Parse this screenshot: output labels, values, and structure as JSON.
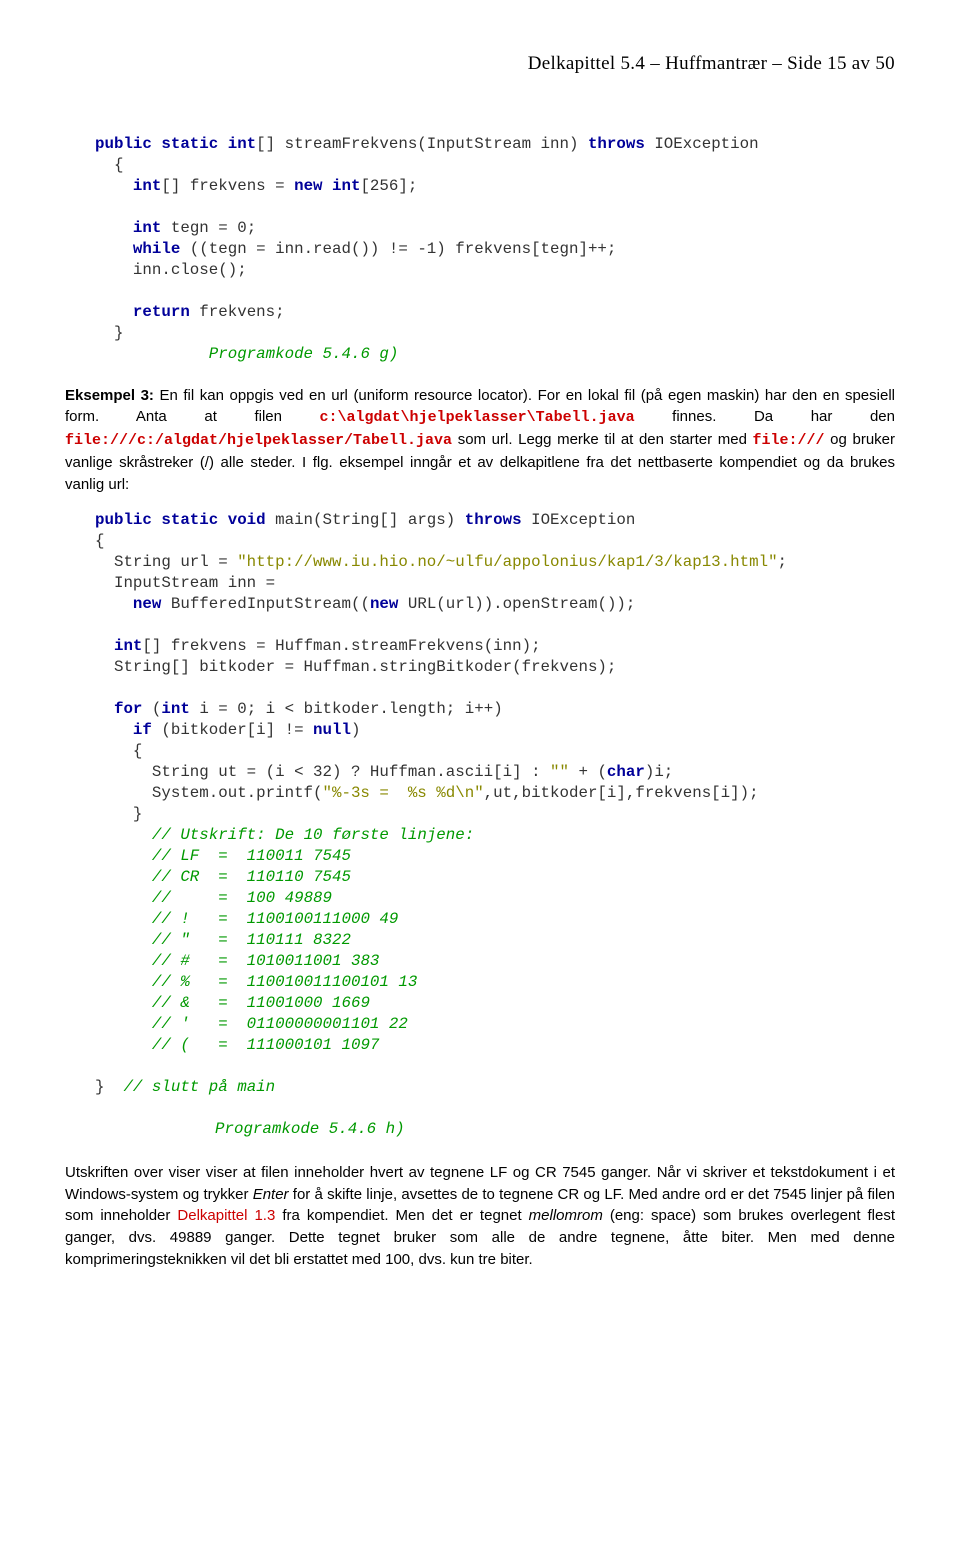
{
  "header": {
    "chapter": "Delkapittel 5.4",
    "title": "Huffmantrær",
    "page": "Side 15 av 50",
    "sep": " – "
  },
  "code1": {
    "l1_kw1": "public static int",
    "l1_rest": "[] streamFrekvens(InputStream inn) ",
    "l1_kw2": "throws",
    "l1_rest2": " IOException",
    "l2": "{",
    "l3_kw": "int",
    "l3_rest": "[] frekvens = ",
    "l3_kw2": "new int",
    "l3_rest2": "[256];",
    "l5_kw": "int",
    "l5_rest": " tegn = 0;",
    "l6_kw": "while",
    "l6_rest": " ((tegn = inn.read()) != -1) frekvens[tegn]++;",
    "l7": "    inn.close();",
    "l9_kw": "return",
    "l9_rest": " frekvens;",
    "l10": "}",
    "label": "Programkode 5.4.6 g)"
  },
  "para1": {
    "bold": "Eksempel 3: ",
    "t1": "En fil kan oppgis ved en url (uniform resource locator). For en lokal fil (på egen maskin) har den en spesiell form. Anta at filen ",
    "m1": "c:\\algdat\\hjelpeklasser\\Tabell.java",
    "t2": " finnes. Da har den ",
    "m2": "file:///c:/algdat/hjelpeklasser/Tabell.java",
    "t3": " som url. Legg merke til at den starter med ",
    "m3": "file:///",
    "t4": " og bruker vanlige skråstreker (/) alle steder. I flg. eksempel inngår et av delkapitlene fra det nettbaserte kompendiet og da brukes vanlig url:"
  },
  "code2": {
    "l1_kw": "public static void",
    "l1_rest": " main(String[] args) ",
    "l1_kw2": "throws",
    "l1_rest2": " IOException",
    "l2": "{",
    "l3_a": "  String url = ",
    "l3_str": "\"http://www.iu.hio.no/~ulfu/appolonius/kap1/3/kap13.html\"",
    "l3_b": ";",
    "l4": "  InputStream inn =",
    "l5_a": "    ",
    "l5_kw": "new",
    "l5_b": " BufferedInputStream((",
    "l5_kw2": "new",
    "l5_c": " URL(url)).openStream());",
    "l7_kw": "int",
    "l7_rest": "[] frekvens = Huffman.streamFrekvens(inn);",
    "l8": "  String[] bitkoder = Huffman.stringBitkoder(frekvens);",
    "l10_kw": "for",
    "l10_a": " (",
    "l10_kw2": "int",
    "l10_b": " i = 0; i < bitkoder.length; i++)",
    "l11_kw": "if",
    "l11_a": " (bitkoder[i] != ",
    "l11_kw2": "null",
    "l11_b": ")",
    "l12": "    {",
    "l13_a": "      String ut = (i < 32) ? Huffman.ascii[i] : ",
    "l13_str": "\"\"",
    "l13_b": " + (",
    "l13_kw": "char",
    "l13_c": ")i;",
    "l14_a": "      System.out.printf(",
    "l14_str": "\"%-3s =  %s %d\\n\"",
    "l14_b": ",ut,bitkoder[i],frekvens[i]);",
    "l15": "    }",
    "c1": "// Utskrift: De 10 første linjene:",
    "c2": "// LF  =  110011 7545",
    "c3": "// CR  =  110110 7545",
    "c4": "//     =  100 49889",
    "c5": "// !   =  1100100111000 49",
    "c6": "// \"   =  110111 8322",
    "c7": "// #   =  1010011001 383",
    "c8": "// %   =  110010011100101 13",
    "c9": "// &   =  11001000 1669",
    "c10": "// '   =  01100000001101 22",
    "c11": "// (   =  111000101 1097",
    "end_a": "}  ",
    "end_cm": "// slutt på main",
    "label": "Programkode 5.4.6 h)"
  },
  "para2": {
    "t1": "Utskriften over viser viser at filen inneholder hvert av tegnene LF og CR 7545 ganger. Når vi skriver et tekstdokument i et Windows-system og trykker ",
    "i1": "Enter",
    "t2": " for å skifte linje, avsettes de to tegnene CR og LF. Med andre ord er det 7545 linjer på filen som inneholder ",
    "link": "Delkapittel 1.3",
    "t3": " fra kompendiet. Men det er tegnet ",
    "i2": "mellomrom",
    "t4": " (eng: space) som brukes overlegent flest ganger, dvs. 49889 ganger. Dette tegnet bruker som alle de andre tegnene, åtte biter. Men med denne komprimeringsteknikken vil det bli erstattet med 100, dvs. kun tre biter."
  }
}
